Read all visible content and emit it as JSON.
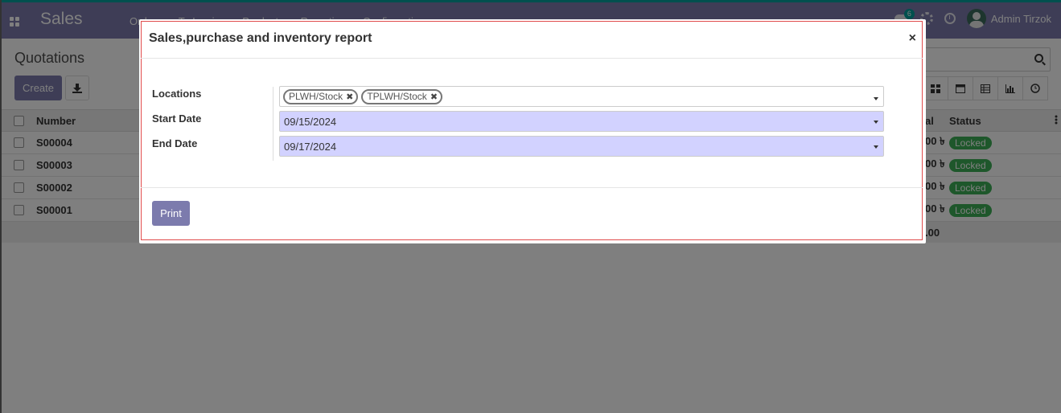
{
  "app": {
    "brand": "Sales",
    "menu": [
      "Orders",
      "To Invoice",
      "Products",
      "Reporting",
      "Configuration"
    ],
    "chat_count": "6",
    "user_name": "Admin Tirzok"
  },
  "control_panel": {
    "title": "Quotations",
    "create_label": "Create"
  },
  "list": {
    "headers": {
      "number": "Number",
      "total": "al",
      "status": "Status"
    },
    "rows": [
      {
        "number": "S00004",
        "total": "00 ৳",
        "status": "Locked"
      },
      {
        "number": "S00003",
        "total": "00 ৳",
        "status": "Locked"
      },
      {
        "number": "S00002",
        "total": "00 ৳",
        "status": "Locked"
      },
      {
        "number": "S00001",
        "total": "00 ৳",
        "status": "Locked"
      }
    ],
    "footer_total": ".00"
  },
  "modal": {
    "title": "Sales,purchase and inventory report",
    "close_glyph": "×",
    "fields": {
      "locations_label": "Locations",
      "locations": [
        "PLWH/Stock",
        "TPLWH/Stock"
      ],
      "start_label": "Start Date",
      "start_value": "09/15/2024",
      "end_label": "End Date",
      "end_value": "09/17/2024"
    },
    "print_label": "Print"
  },
  "colors": {
    "brand": "#7c7bad",
    "accent": "#00a09d",
    "date_field_bg": "#d2d2ff",
    "locked_badge": "#28a745",
    "modal_outline": "#e04a4a"
  }
}
